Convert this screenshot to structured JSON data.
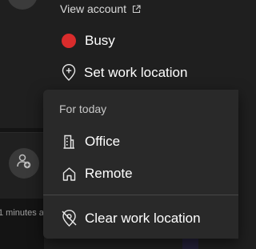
{
  "account": {
    "view_account_label": "View account",
    "external_link_icon": "external-link-icon"
  },
  "status": {
    "label": "Busy",
    "color": "#d92c2c"
  },
  "location": {
    "set_label": "Set work location"
  },
  "flyout": {
    "section_header": "For today",
    "options": [
      {
        "label": "Office",
        "icon": "building-icon"
      },
      {
        "label": "Remote",
        "icon": "home-icon"
      }
    ],
    "clear_label": "Clear work location"
  },
  "background": {
    "activity_text": "1 minutes ago"
  }
}
